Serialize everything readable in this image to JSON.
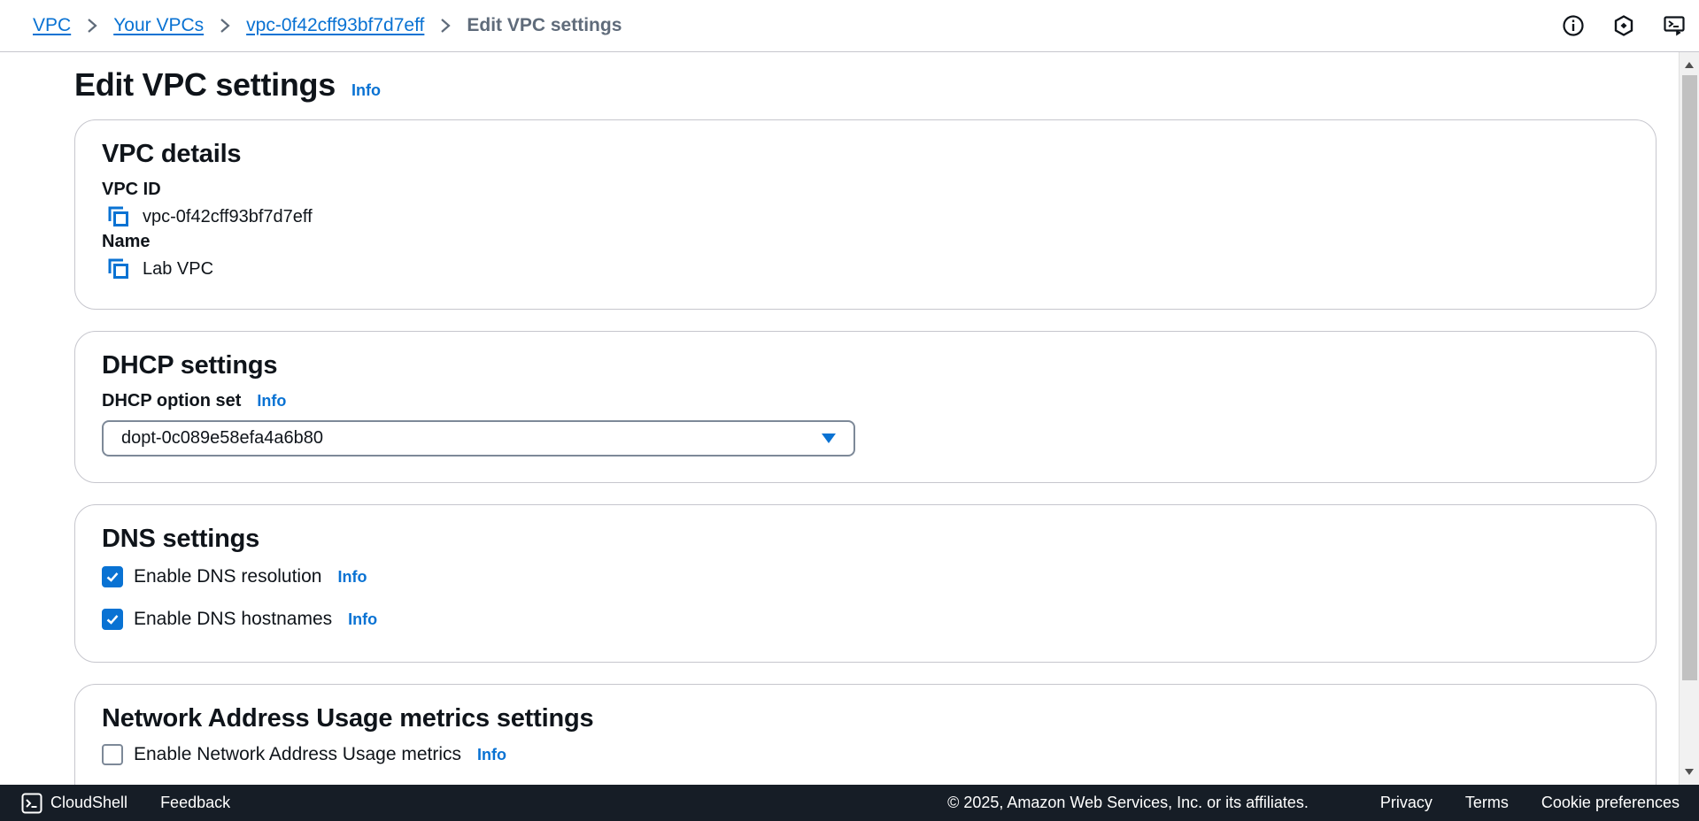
{
  "breadcrumb": {
    "items": [
      "VPC",
      "Your VPCs",
      "vpc-0f42cff93bf7d7eff"
    ],
    "current": "Edit VPC settings"
  },
  "top_icons": [
    "info-circle-icon",
    "settings-hexagon-icon",
    "cloudshell-screen-icon"
  ],
  "page": {
    "title": "Edit VPC settings",
    "info": "Info"
  },
  "vpc_details": {
    "heading": "VPC details",
    "vpc_id_label": "VPC ID",
    "vpc_id_value": "vpc-0f42cff93bf7d7eff",
    "name_label": "Name",
    "name_value": "Lab VPC"
  },
  "dhcp": {
    "heading": "DHCP settings",
    "option_set_label": "DHCP option set",
    "info": "Info",
    "selected": "dopt-0c089e58efa4a6b80"
  },
  "dns": {
    "heading": "DNS settings",
    "resolution_label": "Enable DNS resolution",
    "resolution_checked": true,
    "hostnames_label": "Enable DNS hostnames",
    "hostnames_checked": true,
    "info": "Info"
  },
  "nau": {
    "heading": "Network Address Usage metrics settings",
    "metrics_label": "Enable Network Address Usage metrics",
    "metrics_checked": false,
    "info": "Info"
  },
  "footer": {
    "cloudshell": "CloudShell",
    "feedback": "Feedback",
    "copyright": "© 2025, Amazon Web Services, Inc. or its affiliates.",
    "privacy": "Privacy",
    "terms": "Terms",
    "cookie": "Cookie preferences"
  },
  "colors": {
    "link": "#0972d3",
    "footer_bg": "#161d26",
    "border": "#c6c6cd"
  }
}
